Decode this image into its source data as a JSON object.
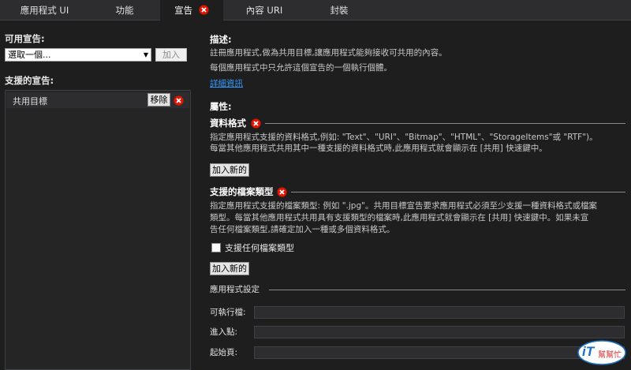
{
  "tabs": [
    {
      "label": "應用程式 UI"
    },
    {
      "label": "功能"
    },
    {
      "label": "宣告",
      "has_error": true
    },
    {
      "label": "內容 URI"
    },
    {
      "label": "封裝"
    }
  ],
  "left": {
    "available_label": "可用宣告:",
    "dropdown_value": "選取一個...",
    "add_button": "加入",
    "supported_label": "支援的宣告:",
    "declarations": [
      {
        "name": "共用目標",
        "remove_label": "移除"
      }
    ]
  },
  "right": {
    "description_heading": "描述:",
    "description_line1": "註冊應用程式,做為共用目標,讓應用程式能夠接收可共用的內容。",
    "description_line2": "每個應用程式中只允許這個宣告的一個執行個體。",
    "more_info_link": "詳細資訊",
    "properties_heading": "屬性:",
    "data_formats": {
      "heading": "資料格式",
      "desc_line1": "指定應用程式支援的資料格式,例如: \"Text\"、\"URI\"、\"Bitmap\"、\"HTML\"、\"StorageItems\"或 \"RTF\")。",
      "desc_line2": "每當其他應用程式共用其中一種支援的資料格式時,此應用程式就會顯示在 [共用] 快速鍵中。",
      "add_new": "加入新的"
    },
    "file_types": {
      "heading": "支援的檔案類型",
      "desc_line1": "指定應用程式支援的檔案類型: 例如 \".jpg\"。共用目標宣告要求應用程式必須至少支援一種資料格式或檔案",
      "desc_line2": "類型。每當其他應用程式共用具有支援類型的檔案時,此應用程式就會顯示在 [共用] 快速鍵中。如果未宣",
      "desc_line3": "告任何檔案類型,請確定加入一種或多個資料格式。",
      "any_type_label": "支援任何檔案類型",
      "add_new": "加入新的"
    },
    "app_settings": {
      "heading": "應用程式設定",
      "executable_label": "可執行檔:",
      "entry_point_label": "進入點:",
      "start_page_label": "起始頁:"
    }
  },
  "watermark": {
    "text_main": "iT",
    "text_sub": "幫幫忙"
  },
  "colors": {
    "background": "#1e1e1e",
    "tabbar": "#2d2d30",
    "error_red": "#e51400",
    "link": "#3399ff"
  }
}
